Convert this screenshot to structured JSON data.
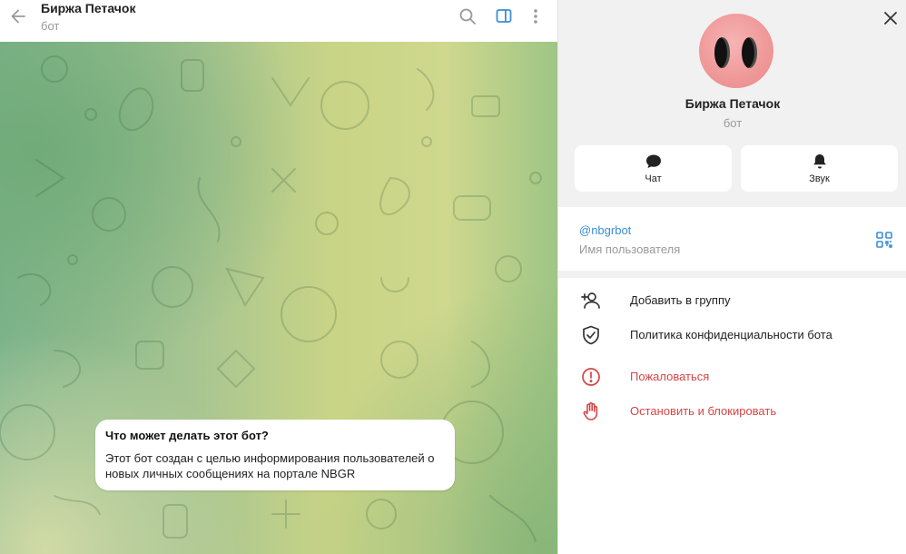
{
  "chat": {
    "title": "Биржа Петачок",
    "status": "бот",
    "icons": [
      "back-arrow-icon",
      "search-icon",
      "sidebar-toggle-icon",
      "more-vertical-icon"
    ],
    "bot_card": {
      "title": "Что может делать этот бот?",
      "text": "Этот бот создан с целью информирования пользователей о новых личных сообщениях на портале NBGR"
    }
  },
  "profile": {
    "name": "Биржа Петачок",
    "status": "бот",
    "actions": [
      {
        "label": "Чат",
        "icon": "chat-bubble-icon"
      },
      {
        "label": "Звук",
        "icon": "bell-icon"
      }
    ],
    "username": "@nbgrbot",
    "username_label": "Имя пользователя",
    "menu": [
      {
        "label": "Добавить в группу",
        "icon": "add-user-icon"
      },
      {
        "label": "Политика конфиденциальности бота",
        "icon": "shield-check-icon"
      },
      {
        "label": "Пожаловаться",
        "icon": "report-icon"
      },
      {
        "label": "Остановить и блокировать",
        "icon": "stop-hand-icon"
      }
    ]
  },
  "colors": {
    "accent": "#3a8fd6",
    "danger": "#d64545",
    "panel_bg": "#f1f1f1",
    "avatar": "#f09a9a"
  }
}
